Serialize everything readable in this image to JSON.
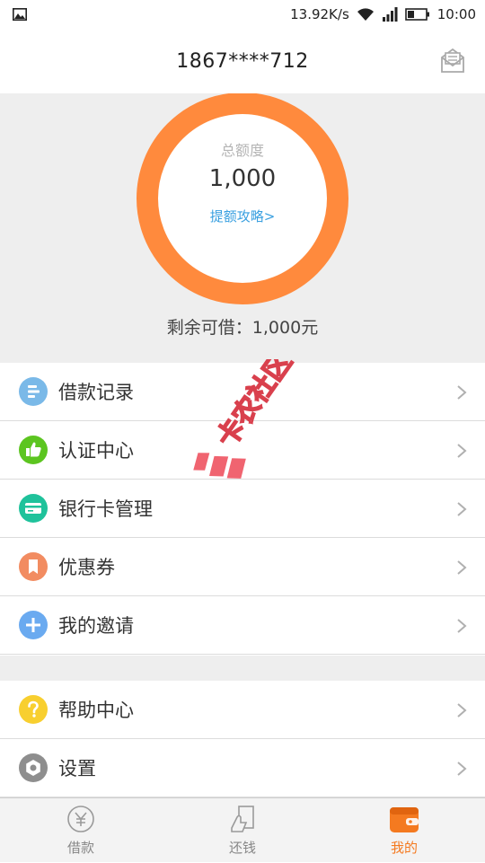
{
  "status_bar": {
    "speed": "13.92K/s",
    "time": "10:00",
    "icons": [
      "image-icon",
      "wifi-icon",
      "signal-icon",
      "battery-icon"
    ]
  },
  "header": {
    "title": "1867****712",
    "icon": "message-icon"
  },
  "credit": {
    "label": "总额度",
    "amount": "1,000",
    "link": "提额攻略>",
    "remaining": "剩余可借：1,000元",
    "ring_color": "#ff8a3d"
  },
  "menu_group_1": [
    {
      "label": "借款记录",
      "icon": "record-icon",
      "color": "#7ab9e8"
    },
    {
      "label": "认证中心",
      "icon": "thumbs-up-icon",
      "color": "#5cc520"
    },
    {
      "label": "银行卡管理",
      "icon": "bank-card-icon",
      "color": "#1fc29b"
    },
    {
      "label": "优惠券",
      "icon": "coupon-icon",
      "color": "#f28c61"
    },
    {
      "label": "我的邀请",
      "icon": "plus-icon",
      "color": "#6aaaf0"
    }
  ],
  "menu_group_2": [
    {
      "label": "帮助中心",
      "icon": "help-icon",
      "color": "#f8cf2f"
    },
    {
      "label": "设置",
      "icon": "settings-icon",
      "color": "#8e8e8e"
    }
  ],
  "tabs": [
    {
      "label": "借款",
      "icon": "yen-icon",
      "active": false
    },
    {
      "label": "还钱",
      "icon": "repay-icon",
      "active": false
    },
    {
      "label": "我的",
      "icon": "wallet-icon",
      "active": true
    }
  ],
  "accent_color": "#f47a20",
  "watermark": {
    "text": "卡农社区"
  }
}
